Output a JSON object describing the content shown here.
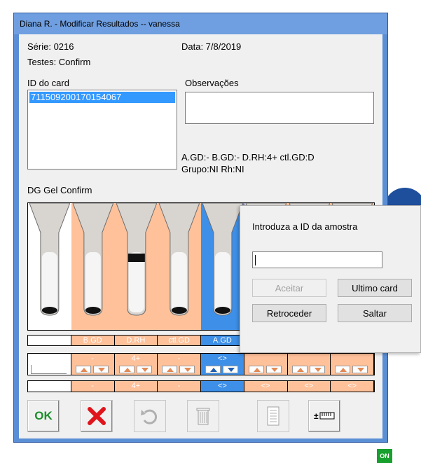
{
  "window": {
    "title": "Diana R. - Modificar Resultados -- vanessa"
  },
  "info": {
    "serie": "Série: 0216",
    "data": "Data: 7/8/2019",
    "testes": "Testes: Confirm"
  },
  "card": {
    "id_label": "ID do card",
    "selected_id": "711509200170154067"
  },
  "observacoes": {
    "label": "Observações",
    "value": ""
  },
  "results": {
    "line1": "A.GD:-  B.GD:-  D.RH:4+  ctl.GD:D",
    "line2": "Grupo:NI  Rh:NI"
  },
  "gel": {
    "title": "DG Gel Confirm",
    "columns": [
      {
        "label": "",
        "color": "#ffffff",
        "value": "",
        "reaction": "-",
        "reading": ""
      },
      {
        "label": "B.GD",
        "color": "#ffc19a",
        "value": "-",
        "reaction": "-",
        "reading": "-"
      },
      {
        "label": "D.RH",
        "color": "#ffc19a",
        "value": "4+",
        "reaction": "4+",
        "reading": "4+"
      },
      {
        "label": "ctl.GD",
        "color": "#ffc19a",
        "value": "-",
        "reaction": "-",
        "reading": "-"
      },
      {
        "label": "A.GD",
        "color": "#3d8fe8",
        "value": "<>",
        "reaction": "-",
        "reading": "<>"
      },
      {
        "label": "",
        "color": "#ffc19a",
        "value": "",
        "reaction": "",
        "reading": "<>"
      },
      {
        "label": "",
        "color": "#ffc19a",
        "value": "",
        "reaction": "",
        "reading": "<>"
      },
      {
        "label": "",
        "color": "#ffc19a",
        "value": "",
        "reaction": "",
        "reading": "<>"
      }
    ]
  },
  "toolbar": {
    "ok_label": "OK",
    "on_badge": "ON",
    "icons": [
      "ok-icon",
      "cancel-x-icon",
      "undo-icon",
      "trash-icon",
      "document-icon",
      "ruler-icon"
    ]
  },
  "popup": {
    "prompt": "Introduza a ID da amostra",
    "input_value": "",
    "accept_label": "Aceitar",
    "last_card_label": "Ultimo card",
    "back_label": "Retroceder",
    "skip_label": "Saltar"
  },
  "colors": {
    "window_frame": "#5a8fd6",
    "peach": "#ffc19a",
    "selected_blue": "#3d8fe8",
    "ok_green": "#1c8f2c",
    "cancel_red": "#e0141c"
  }
}
